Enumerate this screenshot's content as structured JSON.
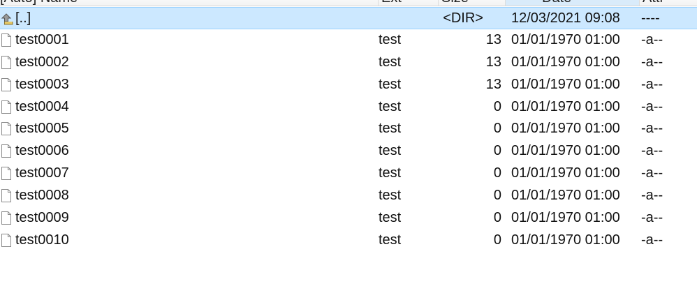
{
  "columns": {
    "name": "[Auto] Name",
    "ext": "Ext",
    "size": "Size",
    "date": "Date",
    "attr": "Attr"
  },
  "parent_row": {
    "name": "[..]",
    "ext": "",
    "size": "<DIR>",
    "date": "12/03/2021 09:08",
    "attr": "----",
    "icon": "folder-up-icon"
  },
  "files": [
    {
      "name": "test0001",
      "ext": "test",
      "size": "13",
      "date": "01/01/1970 01:00",
      "attr": "-a--",
      "icon": "file-icon"
    },
    {
      "name": "test0002",
      "ext": "test",
      "size": "13",
      "date": "01/01/1970 01:00",
      "attr": "-a--",
      "icon": "file-icon"
    },
    {
      "name": "test0003",
      "ext": "test",
      "size": "13",
      "date": "01/01/1970 01:00",
      "attr": "-a--",
      "icon": "file-icon"
    },
    {
      "name": "test0004",
      "ext": "test",
      "size": "0",
      "date": "01/01/1970 01:00",
      "attr": "-a--",
      "icon": "file-icon"
    },
    {
      "name": "test0005",
      "ext": "test",
      "size": "0",
      "date": "01/01/1970 01:00",
      "attr": "-a--",
      "icon": "file-icon"
    },
    {
      "name": "test0006",
      "ext": "test",
      "size": "0",
      "date": "01/01/1970 01:00",
      "attr": "-a--",
      "icon": "file-icon"
    },
    {
      "name": "test0007",
      "ext": "test",
      "size": "0",
      "date": "01/01/1970 01:00",
      "attr": "-a--",
      "icon": "file-icon"
    },
    {
      "name": "test0008",
      "ext": "test",
      "size": "0",
      "date": "01/01/1970 01:00",
      "attr": "-a--",
      "icon": "file-icon"
    },
    {
      "name": "test0009",
      "ext": "test",
      "size": "0",
      "date": "01/01/1970 01:00",
      "attr": "-a--",
      "icon": "file-icon"
    },
    {
      "name": "test0010",
      "ext": "test",
      "size": "0",
      "date": "01/01/1970 01:00",
      "attr": "-a--",
      "icon": "file-icon"
    }
  ],
  "colors": {
    "selection_bg": "#cce8ff",
    "selection_border": "#99d1ff",
    "sorted_header_bg": "#d9ebfa",
    "text": "#111111"
  }
}
